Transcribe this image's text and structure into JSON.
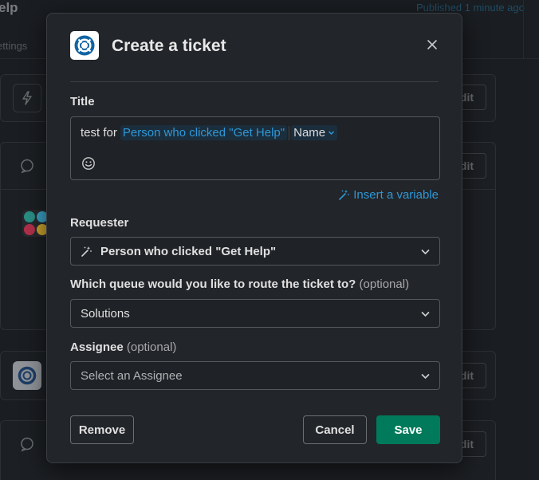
{
  "background": {
    "title_fragment": "elp",
    "published": "Published 1 minute ago",
    "settings_fragment": "ettings",
    "edit_label": "dit"
  },
  "modal": {
    "title": "Create a ticket",
    "title_field": {
      "label": "Title",
      "text": "test for",
      "variable": "Person who clicked \"Get Help\"",
      "variable_property": "Name"
    },
    "insert_variable": "Insert a variable",
    "requester": {
      "label": "Requester",
      "value": "Person who clicked \"Get Help\""
    },
    "queue": {
      "label": "Which queue would you like to route the ticket to?",
      "optional": "(optional)",
      "value": "Solutions"
    },
    "assignee": {
      "label": "Assignee",
      "optional": "(optional)",
      "placeholder": "Select an Assignee"
    },
    "buttons": {
      "remove": "Remove",
      "cancel": "Cancel",
      "save": "Save"
    }
  },
  "colors": {
    "accent_link": "#2f97d6",
    "save_green": "#007a5a",
    "modal_bg": "#222529",
    "page_bg": "#1a1d21"
  }
}
